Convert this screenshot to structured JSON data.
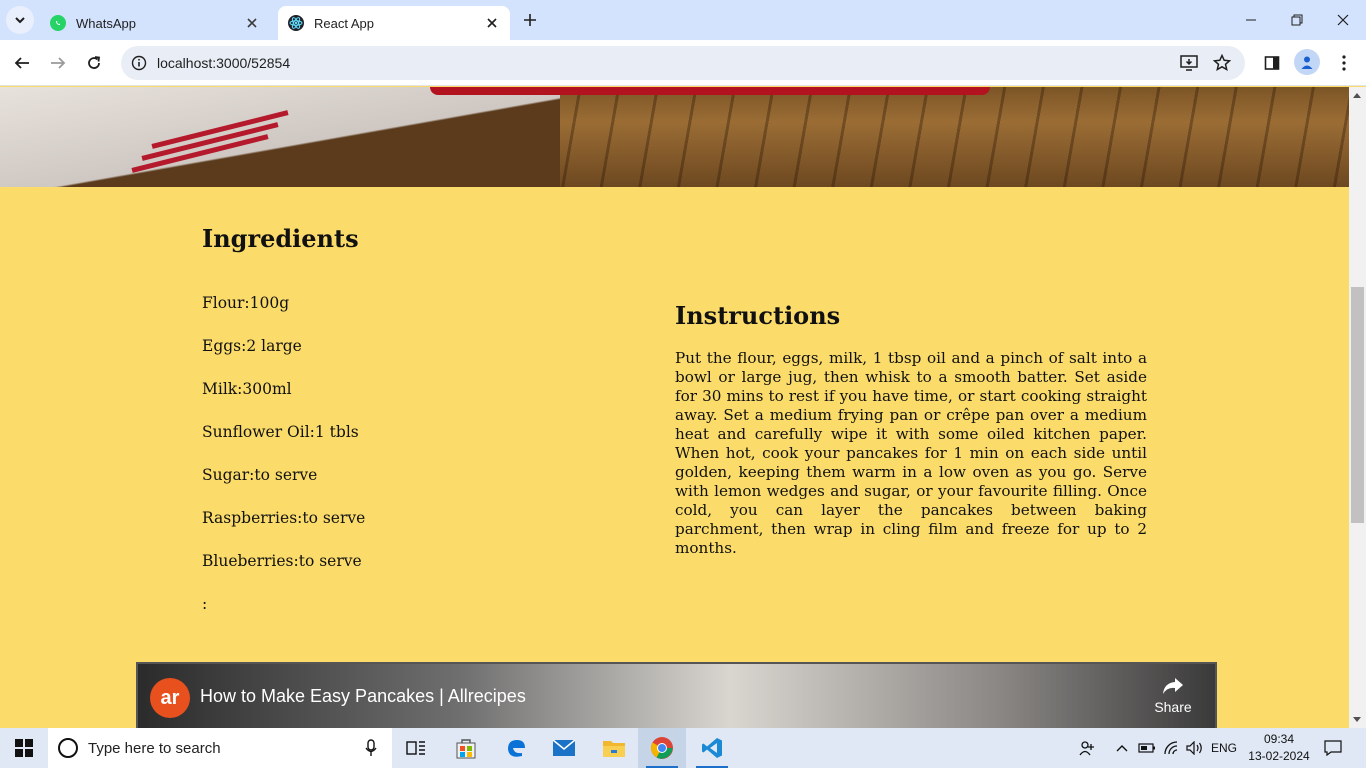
{
  "browser": {
    "tabs": [
      {
        "title": "WhatsApp",
        "icon": "whatsapp-icon"
      },
      {
        "title": "React App",
        "icon": "react-icon"
      }
    ],
    "url": "localhost:3000/52854"
  },
  "page": {
    "ingredients_title": "Ingredients",
    "ingredients": [
      "Flour:100g",
      "Eggs:2 large",
      "Milk:300ml",
      "Sunflower Oil:1 tbls",
      "Sugar:to serve",
      "Raspberries:to serve",
      "Blueberries:to serve",
      ":"
    ],
    "instructions_title": "Instructions",
    "instructions_text": "Put the flour, eggs, milk, 1 tbsp oil and a pinch of salt into a bowl or large jug, then whisk to a smooth batter. Set aside for 30 mins to rest if you have time, or start cooking straight away. Set a medium frying pan or crêpe pan over a medium heat and carefully wipe it with some oiled kitchen paper. When hot, cook your pancakes for 1 min on each side until golden, keeping them warm in a low oven as you go. Serve with lemon wedges and sugar, or your favourite filling. Once cold, you can layer the pancakes between baking parchment, then wrap in cling film and freeze for up to 2 months.",
    "video": {
      "channel_logo": "ar",
      "title": "How to Make Easy Pancakes | Allrecipes",
      "share_label": "Share"
    }
  },
  "taskbar": {
    "search_placeholder": "Type here to search",
    "language": "ENG",
    "time": "09:34",
    "date": "13-02-2024"
  },
  "colors": {
    "page_background": "#fbdc6a",
    "tabstrip": "#d3e3fd",
    "taskbar": "#dfe8f4",
    "whatsapp_green": "#25d366",
    "allrecipes_orange": "#e8501e"
  }
}
